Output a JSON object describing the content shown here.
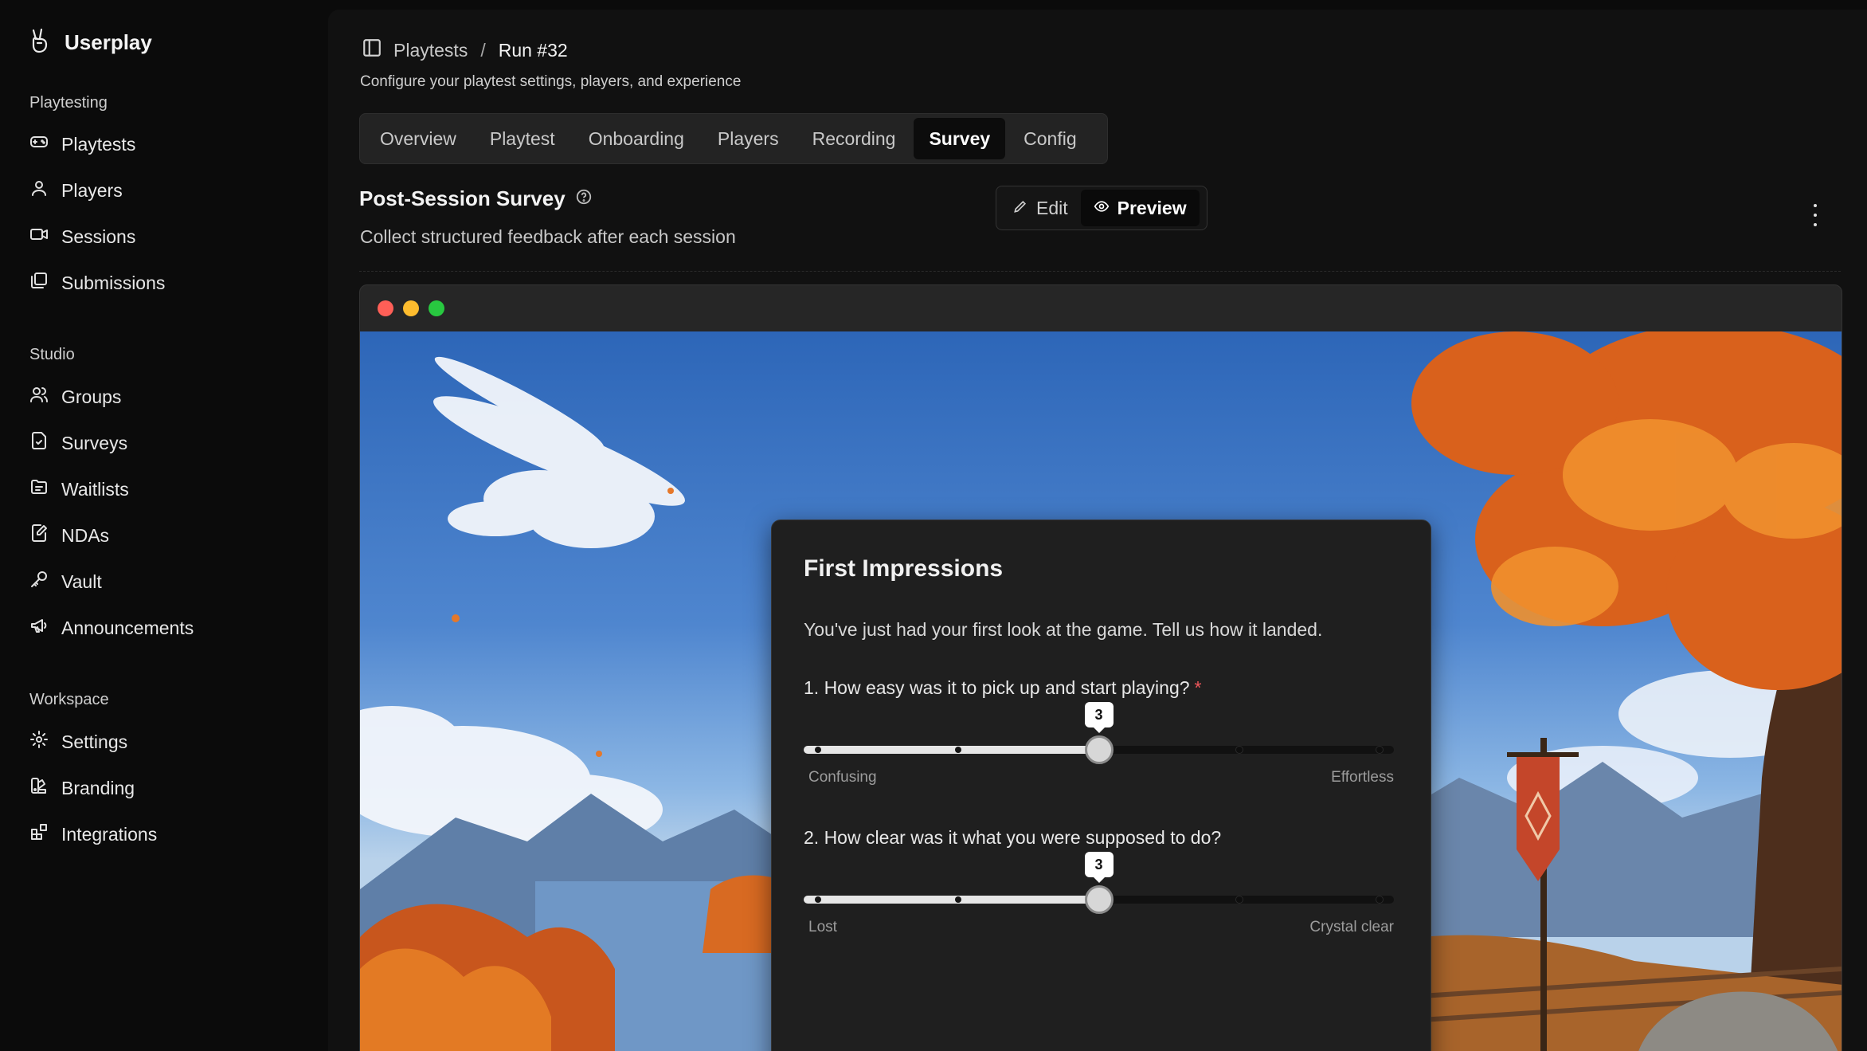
{
  "brand": {
    "name": "Userplay",
    "icon": "peace-hand-icon"
  },
  "sidebar": {
    "sections": [
      {
        "title": "Playtesting",
        "items": [
          {
            "label": "Playtests",
            "icon": "gamepad-icon"
          },
          {
            "label": "Players",
            "icon": "user-icon"
          },
          {
            "label": "Sessions",
            "icon": "video-icon"
          },
          {
            "label": "Submissions",
            "icon": "stack-icon"
          }
        ]
      },
      {
        "title": "Studio",
        "items": [
          {
            "label": "Groups",
            "icon": "users-icon"
          },
          {
            "label": "Surveys",
            "icon": "survey-icon"
          },
          {
            "label": "Waitlists",
            "icon": "folder-list-icon"
          },
          {
            "label": "NDAs",
            "icon": "document-edit-icon"
          },
          {
            "label": "Vault",
            "icon": "key-icon"
          },
          {
            "label": "Announcements",
            "icon": "megaphone-icon"
          }
        ]
      },
      {
        "title": "Workspace",
        "items": [
          {
            "label": "Settings",
            "icon": "gear-icon"
          },
          {
            "label": "Branding",
            "icon": "palette-icon"
          },
          {
            "label": "Integrations",
            "icon": "blocks-icon"
          }
        ]
      }
    ]
  },
  "header": {
    "breadcrumb": {
      "parent": "Playtests",
      "separator": "/",
      "current": "Run #32"
    },
    "subtitle": "Configure your playtest settings, players, and experience"
  },
  "tabs": [
    "Overview",
    "Playtest",
    "Onboarding",
    "Players",
    "Recording",
    "Survey",
    "Config"
  ],
  "active_tab": "Survey",
  "survey": {
    "title": "Post-Session Survey",
    "description": "Collect structured feedback after each session",
    "modes": {
      "edit": "Edit",
      "preview": "Preview",
      "active": "Preview"
    }
  },
  "preview": {
    "card_title": "First Impressions",
    "intro": "You've just had your first look at the game. Tell us how it landed.",
    "questions": [
      {
        "label": "1. How easy was it to pick up and start playing?",
        "required": "*",
        "value": "3",
        "min_label": "Confusing",
        "max_label": "Effortless",
        "steps": 5,
        "selected_fraction": 0.5
      },
      {
        "label": "2. How clear was it what you were supposed to do?",
        "required": "",
        "value": "3",
        "min_label": "Lost",
        "max_label": "Crystal clear",
        "steps": 5,
        "selected_fraction": 0.5
      }
    ]
  },
  "colors": {
    "accent_required": "#f0575b",
    "window_red": "#ff5f57",
    "window_yellow": "#febc2e",
    "window_green": "#28c840"
  }
}
